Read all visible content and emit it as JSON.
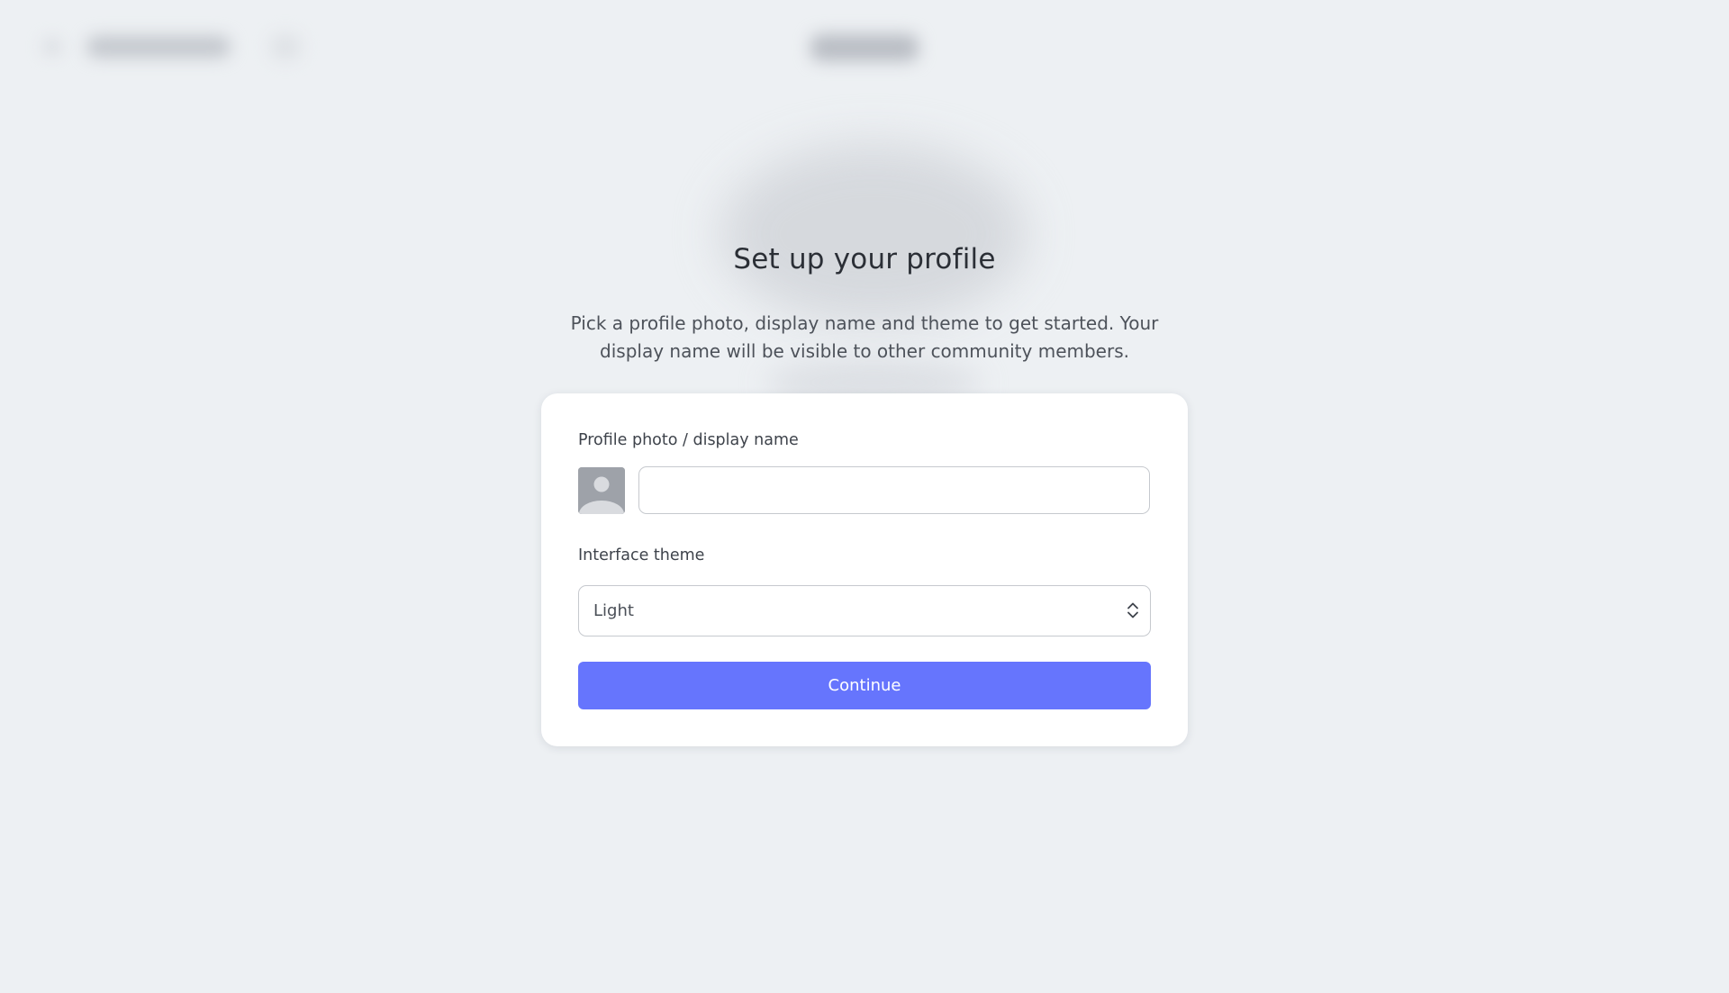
{
  "heading": "Set up your profile",
  "subtitle": "Pick a profile photo, display name and theme to get started. Your display name will be visible to other community members.",
  "form": {
    "profile_label": "Profile photo / display name",
    "display_name_value": "",
    "theme_label": "Interface theme",
    "theme_value": "Light",
    "continue_label": "Continue"
  },
  "icons": {
    "avatar": "user-silhouette-icon",
    "select": "up-down-chevron-icon"
  },
  "colors": {
    "background": "#edf0f3",
    "card": "#ffffff",
    "primary_button": "#6675fd",
    "avatar": "#9ea2a9"
  }
}
